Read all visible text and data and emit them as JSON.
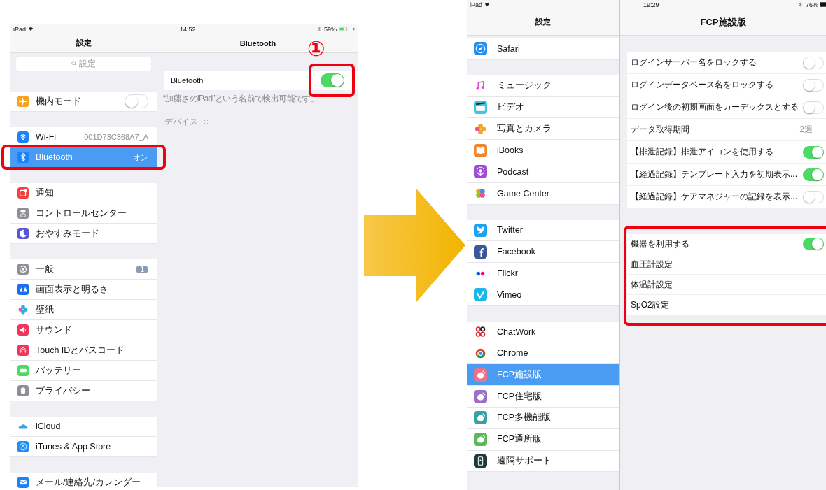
{
  "left_screen": {
    "status_bar": {
      "carrier": "iPad",
      "time": "14:52",
      "battery": "59%"
    },
    "sidebar": {
      "title": "設定",
      "search": {
        "placeholder": "設定"
      },
      "groups": [
        [
          {
            "color": "#f7a21b",
            "label": "機内モード",
            "on": false,
            "selected": false
          }
        ],
        [
          {
            "color": "#1a82fb",
            "label": "Wi-Fi",
            "value": "001D73C368A7_A",
            "selected": false
          },
          {
            "color": "#1a82fb",
            "label": "Bluetooth",
            "value": "オン",
            "selected": true,
            "highlighted": true
          }
        ],
        [
          {
            "color": "#f0403d",
            "label": "通知",
            "selected": false
          },
          {
            "color": "#8e8e93",
            "label": "コントロールセンター",
            "selected": false
          },
          {
            "color": "#5856d6",
            "label": "おやすみモード",
            "selected": false
          }
        ],
        [
          {
            "color": "#8e8e93",
            "label": "一般",
            "badge": "1",
            "selected": false
          },
          {
            "color": "#1a6ff0",
            "label": "画面表示と明るさ",
            "selected": false
          },
          {
            "color": "#36a7e0",
            "label": "壁紙",
            "selected": false
          },
          {
            "color": "#f0365a",
            "label": "サウンド",
            "selected": false
          },
          {
            "color": "#f0365a",
            "label": "Touch IDとパスコード",
            "selected": false
          },
          {
            "color": "#4cd964",
            "label": "バッテリー",
            "selected": false
          },
          {
            "color": "#8e8e93",
            "label": "プライバシー",
            "selected": false
          }
        ],
        [
          {
            "color": "#3aa0e8",
            "label": "iCloud",
            "selected": false
          },
          {
            "color": "#1f8ef5",
            "label": "iTunes & App Store",
            "selected": false
          }
        ],
        [
          {
            "color": "#1a82fb",
            "label": "メール/連絡先/カレンダー",
            "selected": false
          }
        ]
      ]
    },
    "detail": {
      "title": "Bluetooth",
      "rows": [
        {
          "label": "Bluetooth",
          "on": true,
          "highlighted": true,
          "callout": "①"
        }
      ],
      "footer": "“加藤さのiPad”という名前で検出可能です。",
      "section_label": "デバイス"
    }
  },
  "right_screen": {
    "status_bar": {
      "carrier": "iPad",
      "time": "19:29",
      "battery": "76%"
    },
    "sidebar": {
      "title": "設定",
      "groups": [
        [
          {
            "color": "#1c8ef9",
            "label": "Safari",
            "selected": false
          }
        ],
        [
          {
            "color": "#d94ec9",
            "label": "ミュージック",
            "selected": false
          },
          {
            "color": "#3bc7e0",
            "label": "ビデオ",
            "selected": false
          },
          {
            "color": "#f2a52c",
            "label": "写真とカメラ",
            "selected": false
          },
          {
            "color": "#f2852c",
            "label": "iBooks",
            "selected": false
          },
          {
            "color": "#9b4fd6",
            "label": "Podcast",
            "selected": false
          },
          {
            "color": "#f54f82",
            "label": "Game Center",
            "selected": false
          }
        ],
        [
          {
            "color": "#1da1f2",
            "label": "Twitter",
            "selected": false
          },
          {
            "color": "#3b5998",
            "label": "Facebook",
            "selected": false
          },
          {
            "color": "#0063dc",
            "label": "Flickr",
            "selected": false
          },
          {
            "color": "#1ab7ea",
            "label": "Vimeo",
            "selected": false
          }
        ],
        [
          {
            "color": "#e0282e",
            "label": "ChatWork",
            "selected": false
          },
          {
            "color": "#db4437",
            "label": "Chrome",
            "selected": false
          },
          {
            "color": "#e8738a",
            "label": "FCP施設版",
            "selected": true
          },
          {
            "color": "#9a6fc4",
            "label": "FCP住宅版",
            "selected": false
          },
          {
            "color": "#3aa0a8",
            "label": "FCP多機能版",
            "selected": false
          },
          {
            "color": "#5cb85c",
            "label": "FCP通所版",
            "selected": false
          },
          {
            "color": "#1e3a3a",
            "label": "遠隔サポート",
            "selected": false
          }
        ]
      ]
    },
    "detail": {
      "title": "FCP施設版",
      "groups": [
        {
          "highlighted": false,
          "rows": [
            {
              "label": "ログインサーバー名をロックする",
              "on": false
            },
            {
              "label": "ログインデータベース名をロックする",
              "on": false
            },
            {
              "label": "ログイン後の初期画面をカーデックスとする",
              "on": false
            },
            {
              "label": "データ取得期間",
              "value": "2週"
            },
            {
              "label": "【排泄記録】排泄アイコンを使用する",
              "on": true
            },
            {
              "label": "【経過記録】テンプレート入力を初期表示...",
              "on": true
            },
            {
              "label": "【経過記録】ケアマネジャーの記録を表示...",
              "on": false
            }
          ]
        },
        {
          "highlighted": true,
          "rows": [
            {
              "label": "機器を利用する",
              "on": true
            },
            {
              "label": "血圧計設定"
            },
            {
              "label": "体温計設定"
            },
            {
              "label": "SpO2設定"
            }
          ]
        }
      ]
    }
  }
}
